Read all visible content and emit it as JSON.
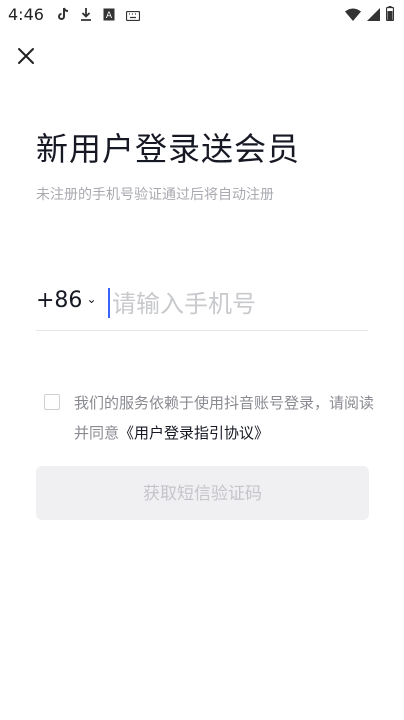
{
  "status_bar": {
    "time": "4:46",
    "left_icons": [
      "tiktok-icon",
      "download-icon",
      "notification-a-icon",
      "keyboard-icon"
    ],
    "right_icons": [
      "wifi-icon",
      "signal-icon",
      "battery-icon"
    ]
  },
  "header": {
    "close_icon": "close-icon"
  },
  "login": {
    "title": "新用户登录送会员",
    "subtitle": "未注册的手机号验证通过后将自动注册",
    "country_code": "+86",
    "country_chevron": "⌄",
    "phone_placeholder": "请输入手机号",
    "phone_value": ""
  },
  "agreement": {
    "checked": false,
    "text": "我们的服务依赖于使用抖音账号登录，请阅读并同意",
    "link": "《用户登录指引协议》"
  },
  "actions": {
    "sms_button": "获取短信验证码"
  },
  "colors": {
    "caret": "#3a64ff",
    "button_bg": "#f0f0f2",
    "button_text": "#c4c5ca",
    "subtitle": "#a9aab0"
  }
}
